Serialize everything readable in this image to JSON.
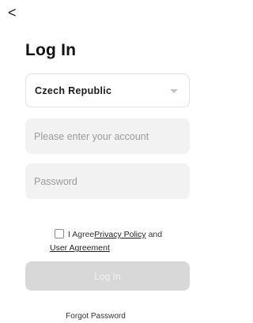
{
  "nav": {
    "back_glyph": "<"
  },
  "title": "Log In",
  "region": {
    "value": "Czech Republic"
  },
  "account": {
    "placeholder": "Please enter your account",
    "value": ""
  },
  "password": {
    "placeholder": "Password",
    "value": ""
  },
  "agreement": {
    "checked": false,
    "prefix": "I Agree",
    "privacy_policy": "Privacy Policy",
    "conjunction": "and",
    "user_agreement": "User Agreement"
  },
  "login_button": {
    "label": "Log In",
    "enabled": false
  },
  "forgot_password": "Forgot Password",
  "colors": {
    "button_disabled_bg": "#d8d8d8",
    "field_bg": "#f2f2f2",
    "placeholder": "#9a9a9a"
  }
}
